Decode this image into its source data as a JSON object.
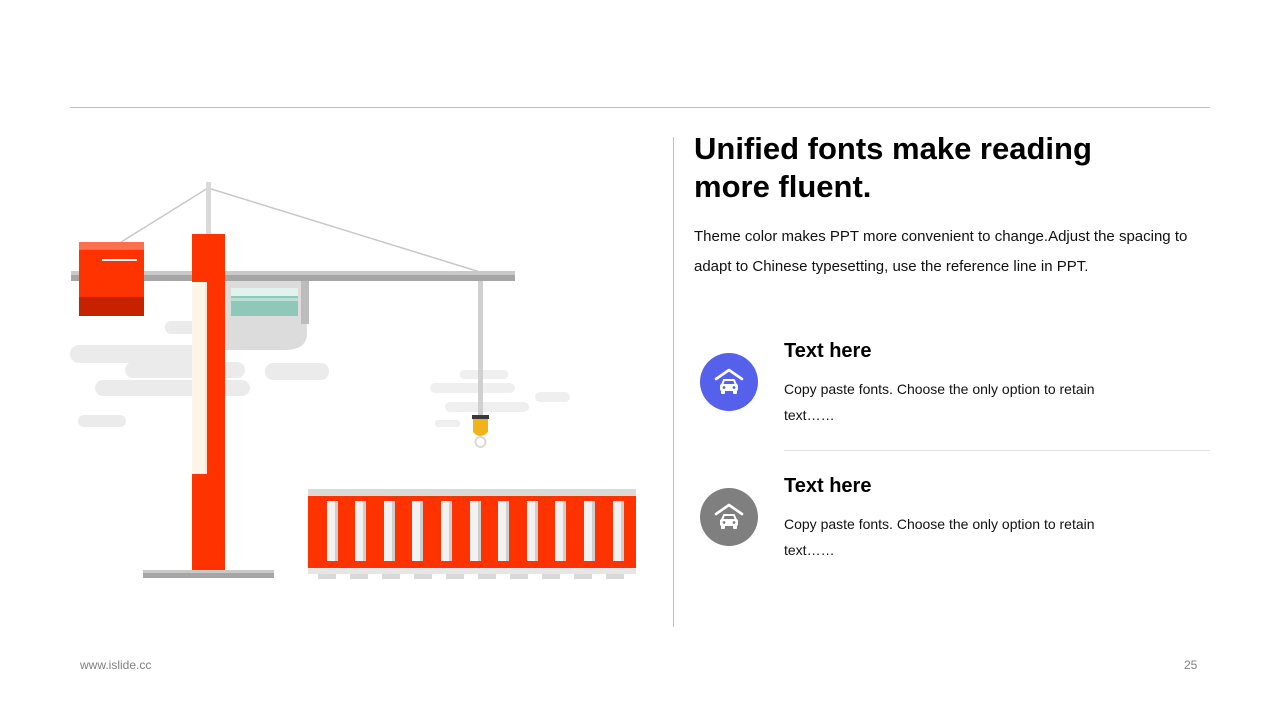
{
  "slide": {
    "headline": "Unified fonts make reading more fluent.",
    "intro": "Theme color makes PPT more convenient to change.Adjust the spacing to adapt to Chinese typesetting, use the reference line in PPT."
  },
  "items": [
    {
      "icon": "car-garage-icon",
      "icon_color": "#5561EB",
      "title": "Text here",
      "body": "Copy paste fonts. Choose the only option to retain text……"
    },
    {
      "icon": "car-garage-icon",
      "icon_color": "#7F7F7F",
      "title": "Text here",
      "body": "Copy paste fonts. Choose the only option to retain text……"
    }
  ],
  "footer": {
    "url": "www.islide.cc",
    "page_number": "25"
  },
  "colors": {
    "accent": "#FF3300",
    "accent_dark": "#C62200",
    "container_green": "#8FC7B8",
    "steel": "#A6A6A6"
  }
}
